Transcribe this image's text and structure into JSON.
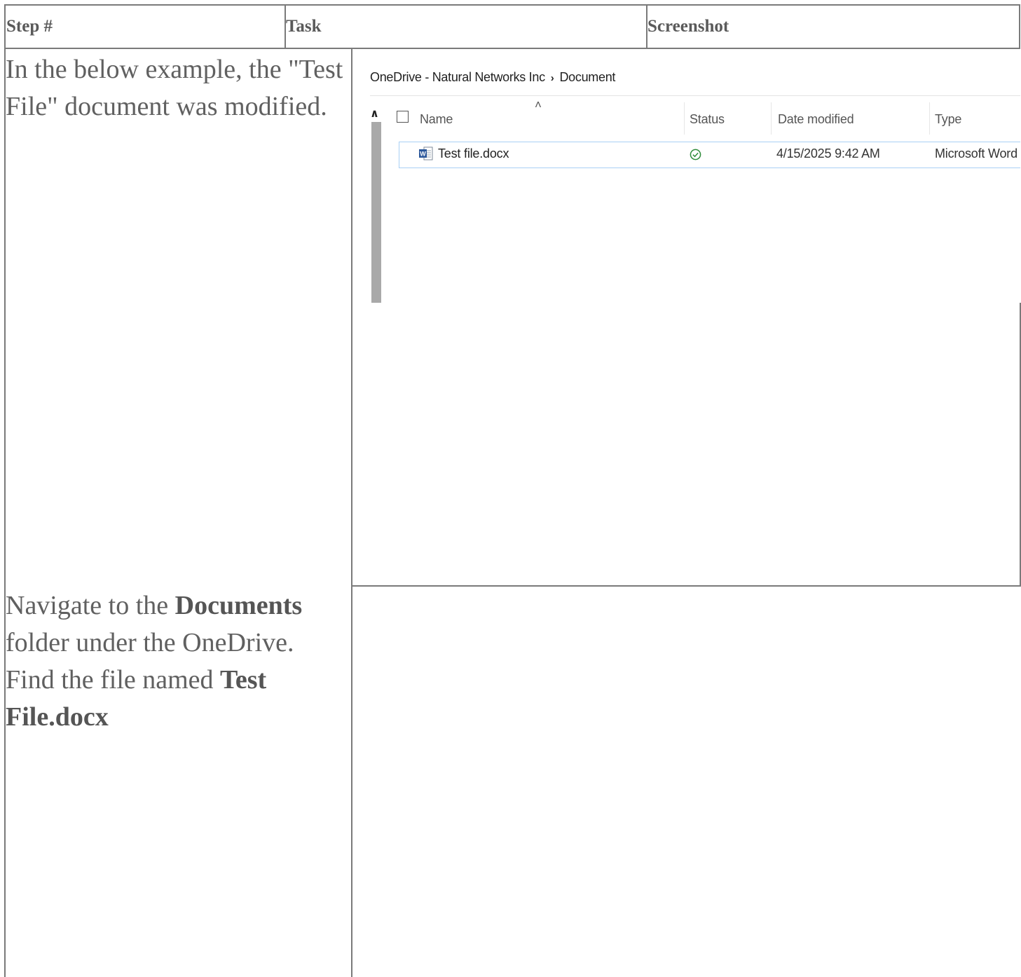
{
  "table": {
    "headers": {
      "step": "Step #",
      "task": "Task",
      "screenshot": "Screenshot"
    },
    "rows": [
      {
        "text": "In the below example, the \"Test File\" document was modified."
      },
      {
        "text_parts": [
          "Navigate to the ",
          "Documents",
          " folder under the OneDrive. Find the file named ",
          "Test File.docx"
        ]
      }
    ]
  },
  "explorer": {
    "breadcrumb": [
      "OneDrive - Natural Networks Inc",
      "Document"
    ],
    "columns": [
      "Name",
      "Status",
      "Date modified",
      "Type"
    ],
    "files": [
      {
        "name": "Test file.docx",
        "status": "synced",
        "date_modified": "4/15/2025 9:42 AM",
        "type": "Microsoft Word D"
      }
    ],
    "colors": {
      "status_green": "#2e8b3a",
      "selection_border": "#a9d0f5",
      "word_blue": "#2b579a"
    }
  }
}
